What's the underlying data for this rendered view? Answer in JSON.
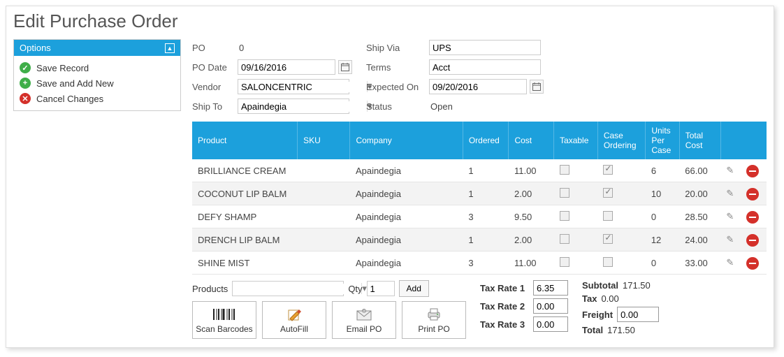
{
  "page": {
    "title": "Edit Purchase Order"
  },
  "options": {
    "header": "Options",
    "items": [
      {
        "icon": "check",
        "color": "green",
        "label": "Save Record"
      },
      {
        "icon": "plus",
        "color": "green",
        "label": "Save and Add New"
      },
      {
        "icon": "x",
        "color": "red",
        "label": "Cancel Changes"
      }
    ]
  },
  "form": {
    "left": {
      "po_label": "PO",
      "po_value": "0",
      "po_date_label": "PO Date",
      "po_date_value": "09/16/2016",
      "vendor_label": "Vendor",
      "vendor_value": "SALONCENTRIC",
      "ship_to_label": "Ship To",
      "ship_to_value": "Apaindegia"
    },
    "right": {
      "ship_via_label": "Ship Via",
      "ship_via_value": "UPS",
      "terms_label": "Terms",
      "terms_value": "Acct",
      "expected_label": "Expected On",
      "expected_value": "09/20/2016",
      "status_label": "Status",
      "status_value": "Open"
    }
  },
  "grid": {
    "headers": {
      "product": "Product",
      "sku": "SKU",
      "company": "Company",
      "ordered": "Ordered",
      "cost": "Cost",
      "taxable": "Taxable",
      "case_ordering": "Case Ordering",
      "upc": "Units Per Case",
      "total_cost": "Total Cost"
    },
    "rows": [
      {
        "product": "BRILLIANCE CREAM",
        "sku": "",
        "company": "Apaindegia",
        "ordered": "1",
        "cost": "11.00",
        "taxable": false,
        "case": true,
        "upc": "6",
        "total": "66.00"
      },
      {
        "product": "COCONUT LIP BALM",
        "sku": "",
        "company": "Apaindegia",
        "ordered": "1",
        "cost": "2.00",
        "taxable": false,
        "case": true,
        "upc": "10",
        "total": "20.00"
      },
      {
        "product": "DEFY SHAMP",
        "sku": "",
        "company": "Apaindegia",
        "ordered": "3",
        "cost": "9.50",
        "taxable": false,
        "case": false,
        "upc": "0",
        "total": "28.50"
      },
      {
        "product": "DRENCH LIP BALM",
        "sku": "",
        "company": "Apaindegia",
        "ordered": "1",
        "cost": "2.00",
        "taxable": false,
        "case": true,
        "upc": "12",
        "total": "24.00"
      },
      {
        "product": "SHINE MIST",
        "sku": "",
        "company": "Apaindegia",
        "ordered": "3",
        "cost": "11.00",
        "taxable": false,
        "case": false,
        "upc": "0",
        "total": "33.00"
      }
    ]
  },
  "add": {
    "label": "Products",
    "qty_label": "Qty",
    "qty_value": "1",
    "add_btn": "Add"
  },
  "actions": {
    "scan": "Scan Barcodes",
    "autofill": "AutoFill",
    "email": "Email PO",
    "print": "Print PO"
  },
  "tax": {
    "rate1_label": "Tax Rate 1",
    "rate1": "6.35",
    "rate2_label": "Tax Rate 2",
    "rate2": "0.00",
    "rate3_label": "Tax Rate 3",
    "rate3": "0.00"
  },
  "totals": {
    "subtotal_label": "Subtotal",
    "subtotal": "171.50",
    "tax_label": "Tax",
    "tax": "0.00",
    "freight_label": "Freight",
    "freight": "0.00",
    "total_label": "Total",
    "total": "171.50"
  }
}
